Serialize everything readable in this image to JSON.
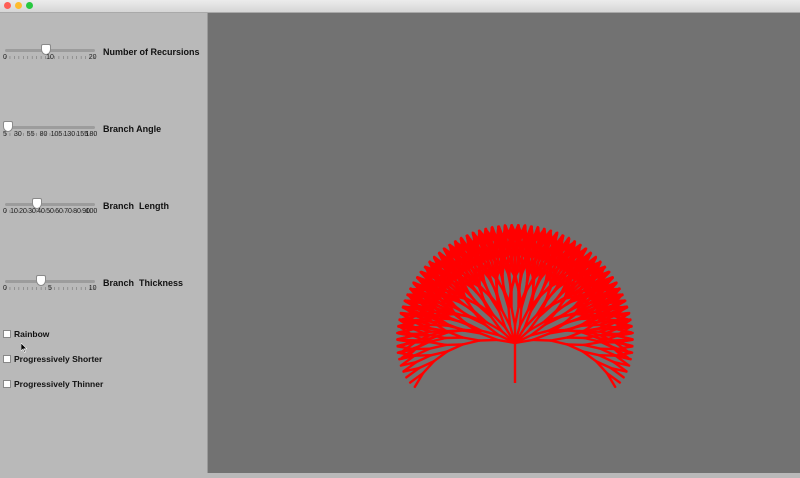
{
  "window": {
    "buttons": [
      {
        "name": "close",
        "color": "#fe5f57"
      },
      {
        "name": "minimize",
        "color": "#febc2e"
      },
      {
        "name": "zoom",
        "color": "#28c840"
      }
    ]
  },
  "controls": {
    "recursions": {
      "label": "Number of Recursions",
      "min": 0,
      "max": 20,
      "value": 9,
      "ticks": [
        "0",
        "10",
        "20"
      ]
    },
    "angle": {
      "label": "Branch Angle",
      "min": 5,
      "max": 180,
      "value": 10,
      "ticks": [
        "5",
        "30",
        "55",
        "80",
        "105",
        "130",
        "155",
        "180"
      ]
    },
    "length": {
      "label": "Branch  Length",
      "min": 0,
      "max": 100,
      "value": 35,
      "ticks": [
        "0",
        "10",
        "20",
        "30",
        "40",
        "50",
        "60",
        "70",
        "80",
        "90",
        "100"
      ]
    },
    "thickness": {
      "label": "Branch  Thickness",
      "min": 0,
      "max": 10,
      "value": 4,
      "ticks": [
        "0",
        "5",
        "10"
      ]
    }
  },
  "options": {
    "rainbow": {
      "label": "Rainbow",
      "checked": false
    },
    "shorter": {
      "label": "Progressively Shorter",
      "checked": false
    },
    "thinner": {
      "label": "Progressively Thinner",
      "checked": false
    }
  },
  "canvas": {
    "background": "#727272",
    "tree_color": "#ff0000"
  }
}
